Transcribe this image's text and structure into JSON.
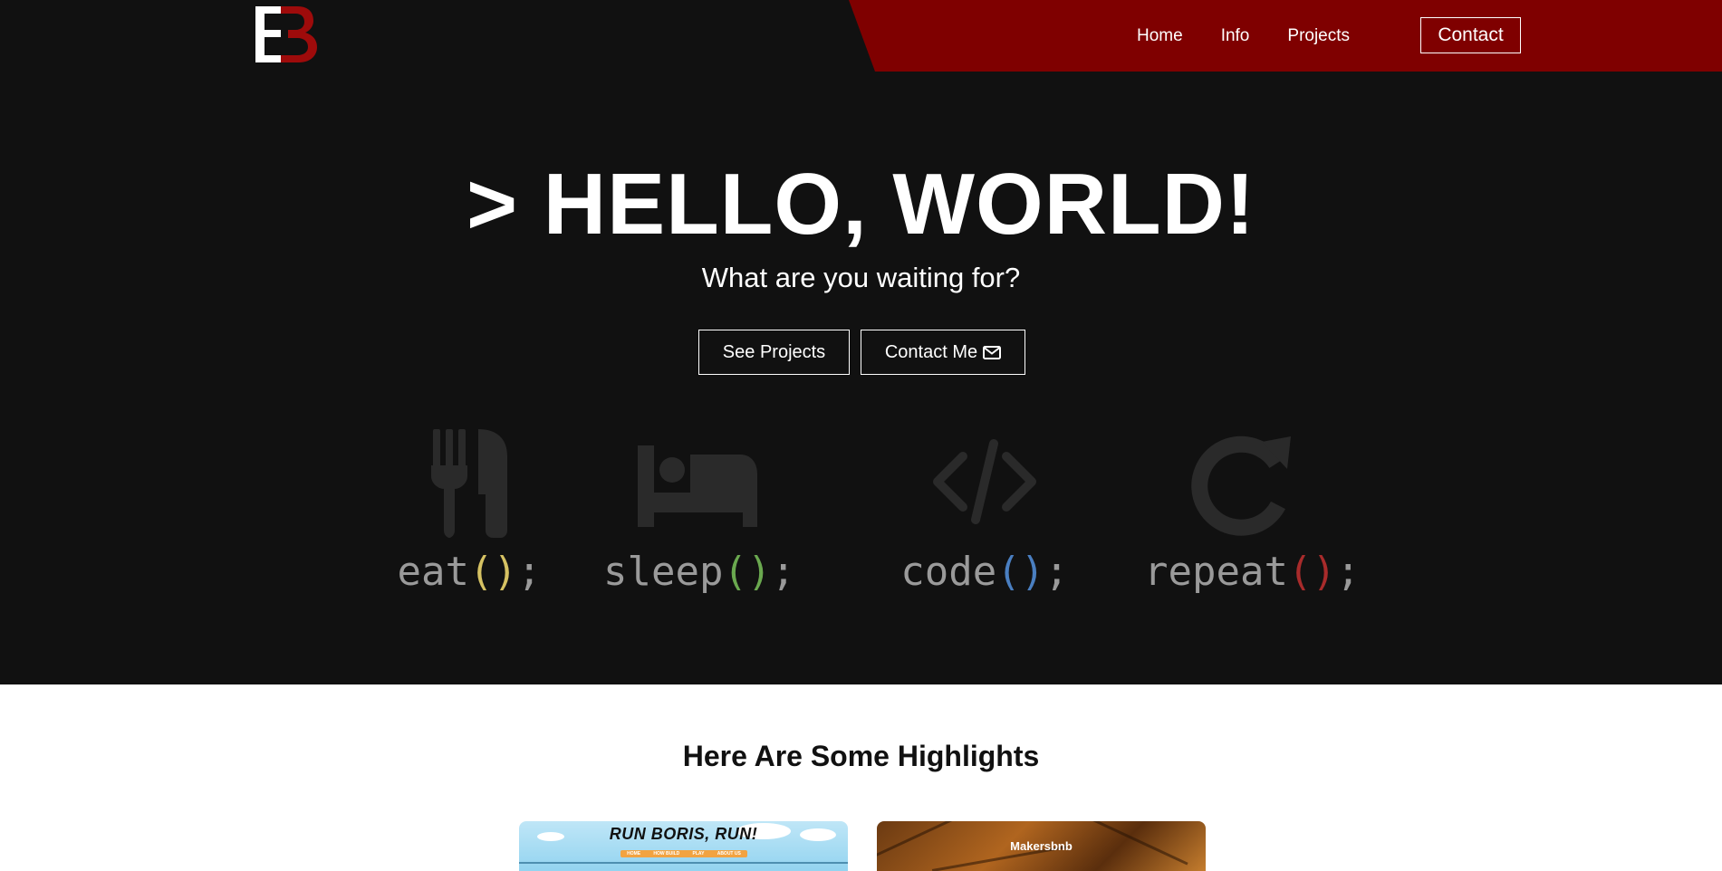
{
  "nav": {
    "logo_alt": "EB",
    "links": [
      "Home",
      "Info",
      "Projects"
    ],
    "contact_label": "Contact"
  },
  "hero": {
    "title": "> HELLO, WORLD!",
    "subtitle": "What are you waiting for?",
    "buttons": {
      "projects": "See Projects",
      "contact": "Contact Me"
    },
    "routine": [
      {
        "icon": "utensils-icon",
        "name": "eat",
        "paren_color": "#d6c263"
      },
      {
        "icon": "bed-icon",
        "name": "sleep",
        "paren_color": "#6aa84f"
      },
      {
        "icon": "code-icon",
        "name": "code",
        "paren_color": "#4a7fc1"
      },
      {
        "icon": "redo-icon",
        "name": "repeat",
        "paren_color": "#a82b2b"
      }
    ]
  },
  "highlights": {
    "title": "Here Are Some Highlights",
    "cards": [
      {
        "title": "RUN BORIS, RUN!",
        "menu": [
          "HOME",
          "HOW BUILD",
          "PLAY",
          "ABOUT US"
        ]
      },
      {
        "title": "Makersbnb"
      }
    ]
  },
  "colors": {
    "nav_bg": "#111111",
    "accent": "#7f0000",
    "hero_bg": "#111111",
    "icon_gray": "#2a2a2a"
  }
}
